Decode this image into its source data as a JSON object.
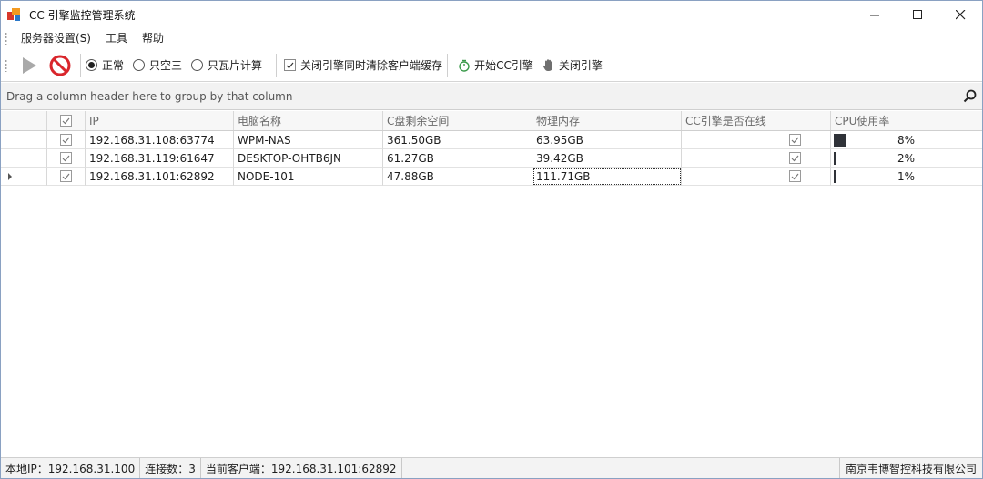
{
  "window": {
    "title": "CC 引擎监控管理系统",
    "controls": {
      "minimize": "—",
      "maximize": "☐",
      "close": "✕"
    }
  },
  "menu": {
    "items": [
      "服务器设置(S)",
      "工具",
      "帮助"
    ]
  },
  "toolbar": {
    "play_icon": "play-icon",
    "stop_icon": "stop-icon",
    "modes": [
      {
        "label": "正常",
        "selected": true
      },
      {
        "label": "只空三",
        "selected": false
      },
      {
        "label": "只瓦片计算",
        "selected": false
      }
    ],
    "clear_cache": {
      "label": "关闭引擎同时清除客户端缓存",
      "checked": true
    },
    "start_engine": "开始CC引擎",
    "stop_engine": "关闭引擎"
  },
  "group_panel": {
    "hint": "Drag a column header here to group by that column"
  },
  "grid": {
    "columns": [
      "IP",
      "电脑名称",
      "C盘剩余空间",
      "物理内存",
      "CC引擎是否在线",
      "CPU使用率"
    ],
    "rows": [
      {
        "checked": true,
        "ip": "192.168.31.108:63774",
        "pc_name": "WPM-NAS",
        "c_free": "361.50GB",
        "memory": "63.95GB",
        "online": true,
        "cpu": "8%",
        "cpu_value": 8
      },
      {
        "checked": true,
        "ip": "192.168.31.119:61647",
        "pc_name": "DESKTOP-OHTB6JN",
        "c_free": "61.27GB",
        "memory": "39.42GB",
        "online": true,
        "cpu": "2%",
        "cpu_value": 2
      },
      {
        "checked": true,
        "ip": "192.168.31.101:62892",
        "pc_name": "NODE-101",
        "c_free": "47.88GB",
        "memory": "111.71GB",
        "online": true,
        "cpu": "1%",
        "cpu_value": 1,
        "current": true
      }
    ]
  },
  "status": {
    "local_ip": "本地IP：192.168.31.100",
    "connections": "连接数：3",
    "current_client": "当前客户端：192.168.31.101:62892",
    "company": "南京韦博智控科技有限公司"
  },
  "colors": {
    "stop_red": "#d9262c",
    "play_gray": "#a9a9a9",
    "start_green": "#3a9a4a",
    "cpu_bar": "#2f3238"
  }
}
